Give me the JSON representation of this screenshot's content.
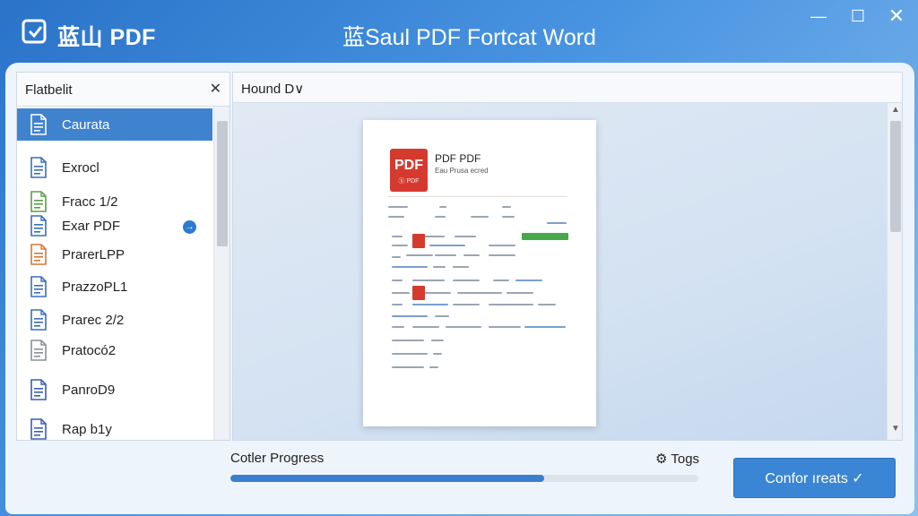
{
  "app": {
    "name": "蓝山 PDF",
    "window_title": "蓝Saul PDF Fortcat Word",
    "controls": {
      "minimize": "—",
      "maximize": "☐",
      "close": "✕"
    }
  },
  "sidebar": {
    "title": "Flatbelit",
    "close": "✕",
    "items": [
      {
        "label": "Caurata",
        "icon": "document-icon",
        "color": "#2f6fbf",
        "selected": true
      },
      {
        "label": "Exrocl",
        "icon": "document-icon",
        "color": "#3a6fb8"
      },
      {
        "label": "Fracc 1/2",
        "icon": "document-icon",
        "color": "#5aa04a"
      },
      {
        "label": "Exar PDF",
        "icon": "document-icon",
        "color": "#3a6fb8",
        "badge": "→"
      },
      {
        "label": "PrarerLPP",
        "icon": "document-icon",
        "color": "#d07a3a"
      },
      {
        "label": "PrazzoPL1",
        "icon": "document-icon",
        "color": "#3a6fb8"
      },
      {
        "label": "Prarec 2/2",
        "icon": "document-icon",
        "color": "#3a6fb8"
      },
      {
        "label": "Pratocó2",
        "icon": "document-icon",
        "color": "#8a8f96"
      },
      {
        "label": "PanroD9",
        "icon": "document-icon",
        "color": "#3a5fb0"
      },
      {
        "label": "Rap b1y",
        "icon": "document-icon",
        "color": "#3a5fb0"
      }
    ]
  },
  "preview": {
    "dropdown": "Hound D∨",
    "page": {
      "logo": "PDF",
      "logo_sub": "ⓑ PDF",
      "title": "PDF PDF",
      "subtitle": "Eau Prusa ecred"
    }
  },
  "progress": {
    "label": "Cotler Progress",
    "value": 0.67
  },
  "toggles": {
    "label": "Togs",
    "icon": "gear-icon"
  },
  "confirm": {
    "label": "Confor ıreats ✓"
  }
}
